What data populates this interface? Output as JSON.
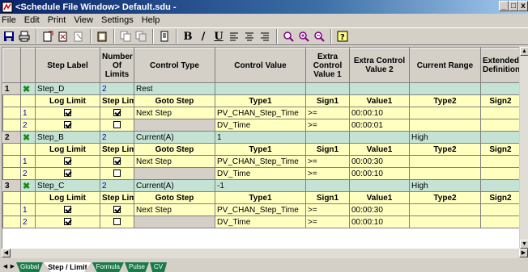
{
  "window": {
    "title": "<Schedule File Window> Default.sdu -",
    "buttons": [
      "_",
      "□",
      "x"
    ]
  },
  "menu": [
    "File",
    "Edit",
    "Print",
    "View",
    "Settings",
    "Help"
  ],
  "toolbar": {
    "icons": [
      "save-icon",
      "print-icon",
      "insert-step-icon",
      "insert-limit-icon",
      "delete-icon",
      "paste-icon",
      "copy-icon",
      "clipboard-icon",
      "bold-icon",
      "italic-icon",
      "underline-icon",
      "align-left-icon",
      "align-right-icon",
      "find-icon",
      "zoom-in-icon",
      "zoom-out-icon",
      "help-icon"
    ],
    "bold": "B",
    "italic": "/",
    "underline": "U"
  },
  "columns": [
    "Step Label",
    "Number Of Limits",
    "Control Type",
    "Control Value",
    "Extra Control Value 1",
    "Extra Control Value 2",
    "Current Range",
    "Extended Definition"
  ],
  "sub_columns": [
    "Log Limit",
    "Step Limit",
    "Goto Step",
    "Type1",
    "Sign1",
    "Value1",
    "Type2",
    "Sign2"
  ],
  "steps": [
    {
      "num": "1",
      "label": "Step_D",
      "limits": "2",
      "control_type": "Rest",
      "control_value": "",
      "extra1": "",
      "extra2": "",
      "range": "",
      "limits_rows": [
        {
          "idx": "1",
          "log": true,
          "step": true,
          "goto": "Next Step",
          "type1": "PV_CHAN_Step_Time",
          "sign1": ">=",
          "value1": "00:00:10"
        },
        {
          "idx": "2",
          "log": true,
          "step": false,
          "goto": "",
          "type1": "DV_Time",
          "sign1": ">=",
          "value1": "00:00:01"
        }
      ]
    },
    {
      "num": "2",
      "label": "Step_B",
      "limits": "2",
      "control_type": "Current(A)",
      "control_value": "1",
      "extra1": "",
      "extra2": "",
      "range": "High",
      "limits_rows": [
        {
          "idx": "1",
          "log": true,
          "step": true,
          "goto": "Next Step",
          "type1": "PV_CHAN_Step_Time",
          "sign1": ">=",
          "value1": "00:00:30"
        },
        {
          "idx": "2",
          "log": true,
          "step": false,
          "goto": "",
          "type1": "DV_Time",
          "sign1": ">=",
          "value1": "00:00:10"
        }
      ]
    },
    {
      "num": "3",
      "label": "Step_C",
      "limits": "2",
      "control_type": "Current(A)",
      "control_value": "-1",
      "extra1": "",
      "extra2": "",
      "range": "High",
      "limits_rows": [
        {
          "idx": "1",
          "log": true,
          "step": true,
          "goto": "Next Step",
          "type1": "PV_CHAN_Step_Time",
          "sign1": ">=",
          "value1": "00:00:30"
        },
        {
          "idx": "2",
          "log": true,
          "step": false,
          "goto": "",
          "type1": "DV_Time",
          "sign1": ">=",
          "value1": "00:00:10"
        }
      ]
    }
  ],
  "tabs": [
    {
      "label": "Global",
      "active": false
    },
    {
      "label": "Step / Limit",
      "active": true
    },
    {
      "label": "Formula",
      "active": false
    },
    {
      "label": "Pulse",
      "active": false
    },
    {
      "label": "CV",
      "active": false
    }
  ],
  "colors": {
    "step_row": "#c5e3d5",
    "limit_row": "#ffffc0",
    "tab": "#1a7a4a"
  }
}
